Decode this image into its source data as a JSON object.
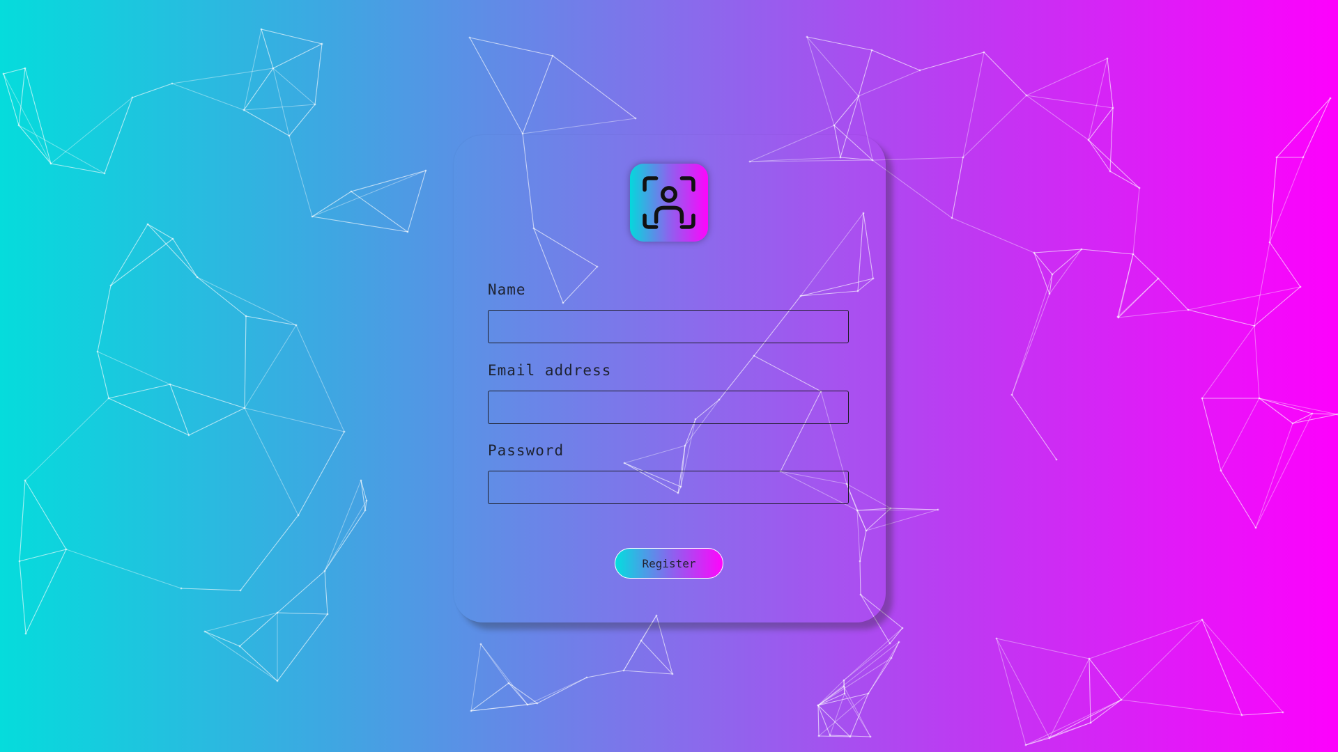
{
  "form": {
    "icon": "user-scan-icon",
    "fields": [
      {
        "label": "Name",
        "value": "",
        "placeholder": ""
      },
      {
        "label": "Email address",
        "value": "",
        "placeholder": ""
      },
      {
        "label": "Password",
        "value": "",
        "placeholder": ""
      }
    ],
    "submit_label": "Register"
  },
  "colors": {
    "gradient_start": "#05dcdc",
    "gradient_mid": "#8a6aec",
    "gradient_end": "#fd01fc",
    "input_border": "#1b1b22",
    "network_lines": "#ffffff"
  }
}
